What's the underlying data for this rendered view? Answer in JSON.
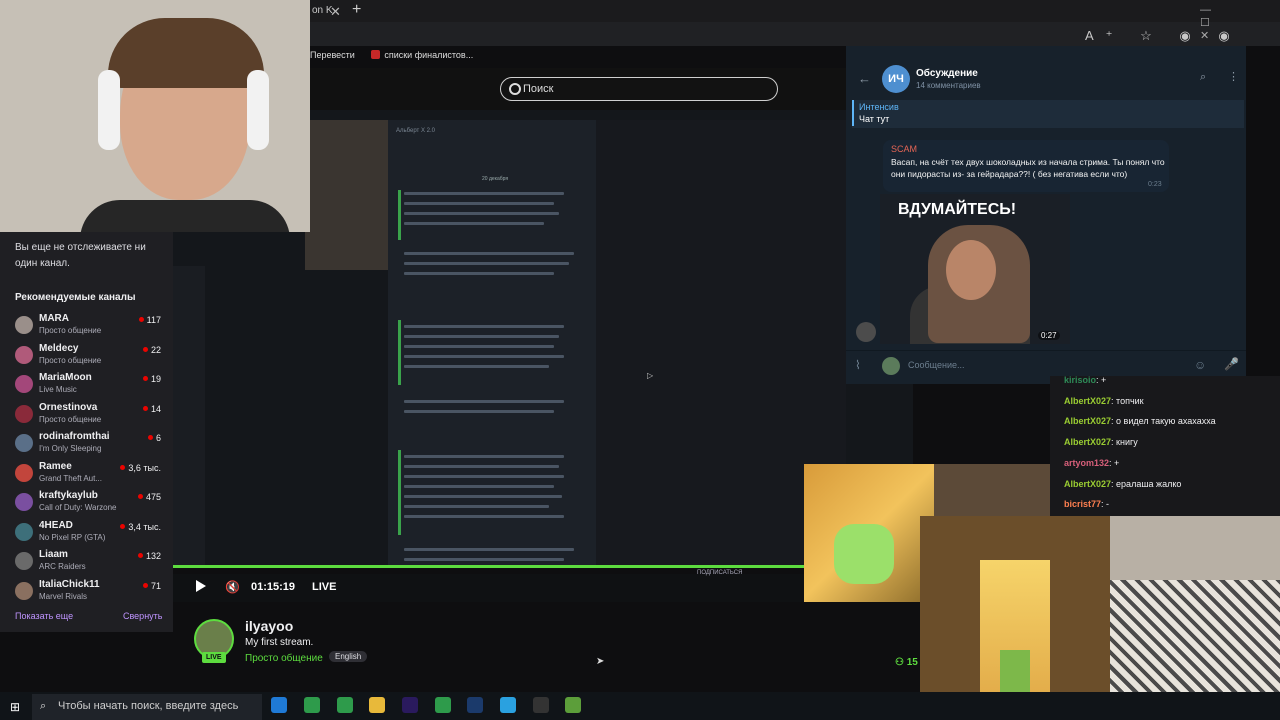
{
  "browser": {
    "tab_text": "on K",
    "tab_close": "✕",
    "tab_new": "+",
    "toolbar_icons": "A⁺ ☆ ◉ ◉ ◉ ⊕ ☷ ☺",
    "window_controls": "— ☐ ✕",
    "bookmarks": [
      "Перевести",
      "списки финалистов..."
    ]
  },
  "twitch": {
    "search_placeholder": "Поиск",
    "sidebar": {
      "no_follow_text": "Вы еще не отслеживаете ни один канал.",
      "recommended_header": "Рекомендуемые каналы",
      "channels": [
        {
          "name": "MARA",
          "game": "Просто общение",
          "viewers": "117",
          "color": "#9a8f8a"
        },
        {
          "name": "Meldecy",
          "game": "Просто общение",
          "viewers": "22",
          "color": "#b05a7a"
        },
        {
          "name": "MariaMoon",
          "game": "Live Music",
          "viewers": "19",
          "color": "#a3477a"
        },
        {
          "name": "Ornestinova",
          "game": "Просто общение",
          "viewers": "14",
          "color": "#8a2a3a"
        },
        {
          "name": "rodinafromthai",
          "game": "I'm Only Sleeping",
          "viewers": "6",
          "color": "#5a6f88"
        },
        {
          "name": "Ramee",
          "game": "Grand Theft Aut...",
          "viewers": "3,6 тыс.",
          "color": "#c2453c"
        },
        {
          "name": "kraftykaylub",
          "game": "Call of Duty: Warzone",
          "viewers": "475",
          "color": "#7a4fa0"
        },
        {
          "name": "4HEAD",
          "game": "No Pixel RP (GTA)",
          "viewers": "3,4 тыс.",
          "color": "#3d6f7a"
        },
        {
          "name": "Liaam",
          "game": "ARC Raiders",
          "viewers": "132",
          "color": "#6a6a6a"
        },
        {
          "name": "ItaliaChick11",
          "game": "Marvel Rivals",
          "viewers": "71",
          "color": "#8a7060"
        }
      ],
      "show_more": "Показать еще",
      "collapse": "Свернуть"
    },
    "player": {
      "time": "01:15:19",
      "live": "LIVE",
      "subscribed": "ПОДПИСАТЬСЯ",
      "progress": 1.0
    },
    "video_doc": {
      "header": "Альберт X 2.0",
      "date": "20 декабря"
    },
    "streamer": {
      "name": "ilyayoo",
      "title": "My first stream.",
      "category": "Просто общение",
      "tag": "English",
      "live_badge": "LIVE",
      "viewers": "15"
    },
    "chat": [
      {
        "user": "kirisoio",
        "color": "#2e8b57",
        "text": "+"
      },
      {
        "user": "AlbertX027",
        "color": "#9acd32",
        "text": "топчик"
      },
      {
        "user": "AlbertX027",
        "color": "#9acd32",
        "text": "о видел такую ахахахха"
      },
      {
        "user": "AlbertX027",
        "color": "#9acd32",
        "text": "книгу"
      },
      {
        "user": "artyom132",
        "color": "#d75f7a",
        "text": "+"
      },
      {
        "user": "AlbertX027",
        "color": "#9acd32",
        "text": "ералаша жалко"
      },
      {
        "user": "bicrist77",
        "color": "#ff7f50",
        "text": "-"
      }
    ]
  },
  "telegram": {
    "avatar_initials": "ИЧ",
    "title": "Обсуждение",
    "subtitle": "14 комментариев",
    "pinned_title": "Интенсив",
    "pinned_text": "Чат тут",
    "message": {
      "author": "SCAM",
      "text": "Васап, на счёт тех двух шоколадных из начала стрима. Ты понял что они пидорасты из- за гейрадара??! ( без негатива если что)",
      "time": "0:23"
    },
    "video": {
      "caption": "ВДУМАЙТЕСЬ!",
      "duration": "0:27"
    },
    "input_placeholder": "Сообщение..."
  },
  "taskbar": {
    "search_placeholder": "Чтобы начать поиск, введите здесь",
    "apps": [
      {
        "name": "edge",
        "color": "#1f7ad6"
      },
      {
        "name": "chrome",
        "color": "#2e9b4b"
      },
      {
        "name": "chrome",
        "color": "#2e9b4b"
      },
      {
        "name": "explorer",
        "color": "#e8b93a"
      },
      {
        "name": "premiere",
        "color": "#2a1a5e"
      },
      {
        "name": "chrome",
        "color": "#2e9b4b"
      },
      {
        "name": "photoshop",
        "color": "#1b3a6b"
      },
      {
        "name": "telegram",
        "color": "#2aa1e0"
      },
      {
        "name": "obs",
        "color": "#333333"
      },
      {
        "name": "minecraft",
        "color": "#5c9e3a"
      }
    ]
  }
}
